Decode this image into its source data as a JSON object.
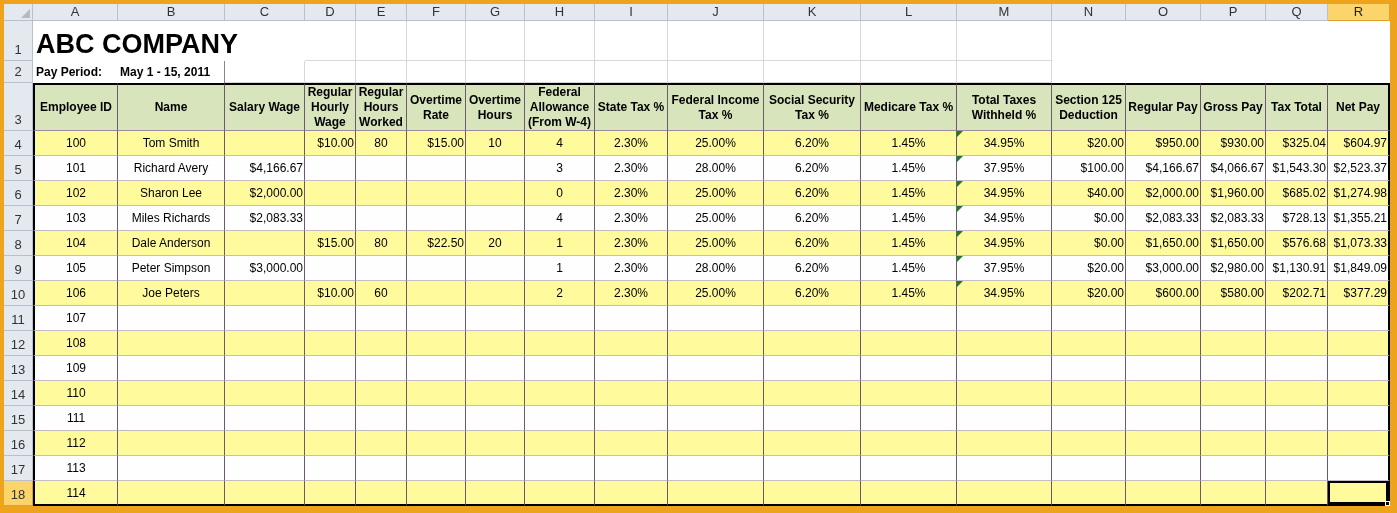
{
  "column_headers": [
    {
      "label": "A",
      "selected": false
    },
    {
      "label": "B",
      "selected": false
    },
    {
      "label": "C",
      "selected": false
    },
    {
      "label": "D",
      "selected": false
    },
    {
      "label": "E",
      "selected": false
    },
    {
      "label": "F",
      "selected": false
    },
    {
      "label": "G",
      "selected": false
    },
    {
      "label": "H",
      "selected": false
    },
    {
      "label": "I",
      "selected": false
    },
    {
      "label": "J",
      "selected": false
    },
    {
      "label": "K",
      "selected": false
    },
    {
      "label": "L",
      "selected": false
    },
    {
      "label": "M",
      "selected": false
    },
    {
      "label": "N",
      "selected": false
    },
    {
      "label": "O",
      "selected": false
    },
    {
      "label": "P",
      "selected": false
    },
    {
      "label": "Q",
      "selected": false
    },
    {
      "label": "R",
      "selected": true
    }
  ],
  "title": {
    "row_number": "1",
    "selected": false,
    "text": "ABC COMPANY"
  },
  "pay_period": {
    "row_number": "2",
    "selected": false,
    "label": "Pay Period:",
    "value": "May 1 - 15, 2011"
  },
  "header_row": {
    "row_number": "3",
    "selected": false,
    "labels": [
      "Employee ID",
      "Name",
      "Salary Wage",
      "Regular Hourly Wage",
      "Regular Hours Worked",
      "Overtime Rate",
      "Overtime Hours",
      "Federal Allowance (From W-4)",
      "State Tax %",
      "Federal Income Tax %",
      "Social Security Tax %",
      "Medicare Tax %",
      "Total Taxes Withheld %",
      "Section 125 Deduction",
      "Regular Pay",
      "Gross Pay",
      "Tax Total",
      "Net Pay"
    ]
  },
  "rows": [
    {
      "row_number": "4",
      "selected": false,
      "flagged": true,
      "cells": [
        "100",
        "Tom Smith",
        null,
        "$10.00",
        "80",
        "$15.00",
        "10",
        "4",
        "2.30%",
        "25.00%",
        "6.20%",
        "1.45%",
        "34.95%",
        "$20.00",
        "$950.00",
        "$930.00",
        "$325.04",
        "$604.97"
      ]
    },
    {
      "row_number": "5",
      "selected": false,
      "flagged": true,
      "cells": [
        "101",
        "Richard Avery",
        "$4,166.67",
        null,
        null,
        null,
        null,
        "3",
        "2.30%",
        "28.00%",
        "6.20%",
        "1.45%",
        "37.95%",
        "$100.00",
        "$4,166.67",
        "$4,066.67",
        "$1,543.30",
        "$2,523.37"
      ]
    },
    {
      "row_number": "6",
      "selected": false,
      "flagged": true,
      "cells": [
        "102",
        "Sharon Lee",
        "$2,000.00",
        null,
        null,
        null,
        null,
        "0",
        "2.30%",
        "25.00%",
        "6.20%",
        "1.45%",
        "34.95%",
        "$40.00",
        "$2,000.00",
        "$1,960.00",
        "$685.02",
        "$1,274.98"
      ]
    },
    {
      "row_number": "7",
      "selected": false,
      "flagged": true,
      "cells": [
        "103",
        "Miles Richards",
        "$2,083.33",
        null,
        null,
        null,
        null,
        "4",
        "2.30%",
        "25.00%",
        "6.20%",
        "1.45%",
        "34.95%",
        "$0.00",
        "$2,083.33",
        "$2,083.33",
        "$728.13",
        "$1,355.21"
      ]
    },
    {
      "row_number": "8",
      "selected": false,
      "flagged": true,
      "cells": [
        "104",
        "Dale Anderson",
        null,
        "$15.00",
        "80",
        "$22.50",
        "20",
        "1",
        "2.30%",
        "25.00%",
        "6.20%",
        "1.45%",
        "34.95%",
        "$0.00",
        "$1,650.00",
        "$1,650.00",
        "$576.68",
        "$1,073.33"
      ]
    },
    {
      "row_number": "9",
      "selected": false,
      "flagged": true,
      "cells": [
        "105",
        "Peter Simpson",
        "$3,000.00",
        null,
        null,
        null,
        null,
        "1",
        "2.30%",
        "28.00%",
        "6.20%",
        "1.45%",
        "37.95%",
        "$20.00",
        "$3,000.00",
        "$2,980.00",
        "$1,130.91",
        "$1,849.09"
      ]
    },
    {
      "row_number": "10",
      "selected": false,
      "flagged": true,
      "cells": [
        "106",
        "Joe Peters",
        null,
        "$10.00",
        "60",
        null,
        null,
        "2",
        "2.30%",
        "25.00%",
        "6.20%",
        "1.45%",
        "34.95%",
        "$20.00",
        "$600.00",
        "$580.00",
        "$202.71",
        "$377.29"
      ]
    },
    {
      "row_number": "11",
      "selected": false,
      "flagged": false,
      "cells": [
        "107",
        null,
        null,
        null,
        null,
        null,
        null,
        null,
        null,
        null,
        null,
        null,
        null,
        null,
        null,
        null,
        null,
        null
      ]
    },
    {
      "row_number": "12",
      "selected": false,
      "flagged": false,
      "cells": [
        "108",
        null,
        null,
        null,
        null,
        null,
        null,
        null,
        null,
        null,
        null,
        null,
        null,
        null,
        null,
        null,
        null,
        null
      ]
    },
    {
      "row_number": "13",
      "selected": false,
      "flagged": false,
      "cells": [
        "109",
        null,
        null,
        null,
        null,
        null,
        null,
        null,
        null,
        null,
        null,
        null,
        null,
        null,
        null,
        null,
        null,
        null
      ]
    },
    {
      "row_number": "14",
      "selected": false,
      "flagged": false,
      "cells": [
        "110",
        null,
        null,
        null,
        null,
        null,
        null,
        null,
        null,
        null,
        null,
        null,
        null,
        null,
        null,
        null,
        null,
        null
      ]
    },
    {
      "row_number": "15",
      "selected": false,
      "flagged": false,
      "cells": [
        "111",
        null,
        null,
        null,
        null,
        null,
        null,
        null,
        null,
        null,
        null,
        null,
        null,
        null,
        null,
        null,
        null,
        null
      ]
    },
    {
      "row_number": "16",
      "selected": false,
      "flagged": false,
      "cells": [
        "112",
        null,
        null,
        null,
        null,
        null,
        null,
        null,
        null,
        null,
        null,
        null,
        null,
        null,
        null,
        null,
        null,
        null
      ]
    },
    {
      "row_number": "17",
      "selected": false,
      "flagged": false,
      "cells": [
        "113",
        null,
        null,
        null,
        null,
        null,
        null,
        null,
        null,
        null,
        null,
        null,
        null,
        null,
        null,
        null,
        null,
        null
      ]
    },
    {
      "row_number": "18",
      "selected": true,
      "flagged": false,
      "cells": [
        "114",
        null,
        null,
        null,
        null,
        null,
        null,
        null,
        null,
        null,
        null,
        null,
        null,
        null,
        null,
        null,
        null,
        null
      ]
    }
  ]
}
